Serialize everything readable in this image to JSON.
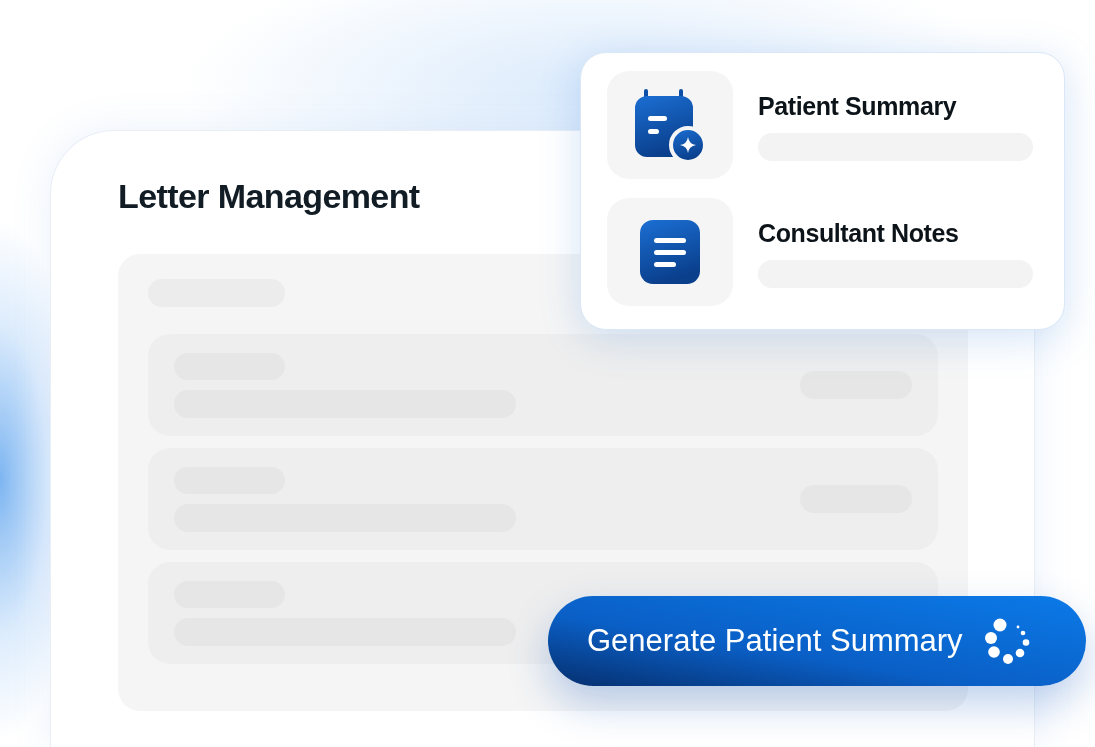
{
  "main_card": {
    "title": "Letter Management"
  },
  "summary_card": {
    "items": [
      {
        "title": "Patient Summary"
      },
      {
        "title": "Consultant Notes"
      }
    ]
  },
  "generate_button": {
    "label": "Generate Patient Summary",
    "loading": true
  }
}
